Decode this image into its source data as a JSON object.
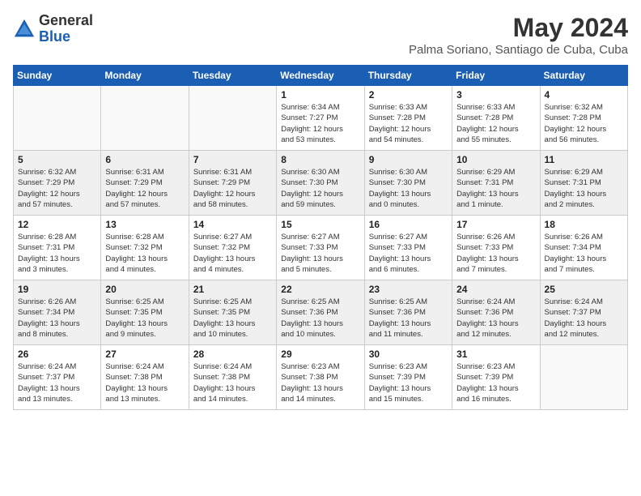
{
  "logo": {
    "general": "General",
    "blue": "Blue"
  },
  "title": "May 2024",
  "subtitle": "Palma Soriano, Santiago de Cuba, Cuba",
  "days_of_week": [
    "Sunday",
    "Monday",
    "Tuesday",
    "Wednesday",
    "Thursday",
    "Friday",
    "Saturday"
  ],
  "weeks": [
    [
      {
        "day": "",
        "info": ""
      },
      {
        "day": "",
        "info": ""
      },
      {
        "day": "",
        "info": ""
      },
      {
        "day": "1",
        "info": "Sunrise: 6:34 AM\nSunset: 7:27 PM\nDaylight: 12 hours\nand 53 minutes."
      },
      {
        "day": "2",
        "info": "Sunrise: 6:33 AM\nSunset: 7:28 PM\nDaylight: 12 hours\nand 54 minutes."
      },
      {
        "day": "3",
        "info": "Sunrise: 6:33 AM\nSunset: 7:28 PM\nDaylight: 12 hours\nand 55 minutes."
      },
      {
        "day": "4",
        "info": "Sunrise: 6:32 AM\nSunset: 7:28 PM\nDaylight: 12 hours\nand 56 minutes."
      }
    ],
    [
      {
        "day": "5",
        "info": "Sunrise: 6:32 AM\nSunset: 7:29 PM\nDaylight: 12 hours\nand 57 minutes."
      },
      {
        "day": "6",
        "info": "Sunrise: 6:31 AM\nSunset: 7:29 PM\nDaylight: 12 hours\nand 57 minutes."
      },
      {
        "day": "7",
        "info": "Sunrise: 6:31 AM\nSunset: 7:29 PM\nDaylight: 12 hours\nand 58 minutes."
      },
      {
        "day": "8",
        "info": "Sunrise: 6:30 AM\nSunset: 7:30 PM\nDaylight: 12 hours\nand 59 minutes."
      },
      {
        "day": "9",
        "info": "Sunrise: 6:30 AM\nSunset: 7:30 PM\nDaylight: 13 hours\nand 0 minutes."
      },
      {
        "day": "10",
        "info": "Sunrise: 6:29 AM\nSunset: 7:31 PM\nDaylight: 13 hours\nand 1 minute."
      },
      {
        "day": "11",
        "info": "Sunrise: 6:29 AM\nSunset: 7:31 PM\nDaylight: 13 hours\nand 2 minutes."
      }
    ],
    [
      {
        "day": "12",
        "info": "Sunrise: 6:28 AM\nSunset: 7:31 PM\nDaylight: 13 hours\nand 3 minutes."
      },
      {
        "day": "13",
        "info": "Sunrise: 6:28 AM\nSunset: 7:32 PM\nDaylight: 13 hours\nand 4 minutes."
      },
      {
        "day": "14",
        "info": "Sunrise: 6:27 AM\nSunset: 7:32 PM\nDaylight: 13 hours\nand 4 minutes."
      },
      {
        "day": "15",
        "info": "Sunrise: 6:27 AM\nSunset: 7:33 PM\nDaylight: 13 hours\nand 5 minutes."
      },
      {
        "day": "16",
        "info": "Sunrise: 6:27 AM\nSunset: 7:33 PM\nDaylight: 13 hours\nand 6 minutes."
      },
      {
        "day": "17",
        "info": "Sunrise: 6:26 AM\nSunset: 7:33 PM\nDaylight: 13 hours\nand 7 minutes."
      },
      {
        "day": "18",
        "info": "Sunrise: 6:26 AM\nSunset: 7:34 PM\nDaylight: 13 hours\nand 7 minutes."
      }
    ],
    [
      {
        "day": "19",
        "info": "Sunrise: 6:26 AM\nSunset: 7:34 PM\nDaylight: 13 hours\nand 8 minutes."
      },
      {
        "day": "20",
        "info": "Sunrise: 6:25 AM\nSunset: 7:35 PM\nDaylight: 13 hours\nand 9 minutes."
      },
      {
        "day": "21",
        "info": "Sunrise: 6:25 AM\nSunset: 7:35 PM\nDaylight: 13 hours\nand 10 minutes."
      },
      {
        "day": "22",
        "info": "Sunrise: 6:25 AM\nSunset: 7:36 PM\nDaylight: 13 hours\nand 10 minutes."
      },
      {
        "day": "23",
        "info": "Sunrise: 6:25 AM\nSunset: 7:36 PM\nDaylight: 13 hours\nand 11 minutes."
      },
      {
        "day": "24",
        "info": "Sunrise: 6:24 AM\nSunset: 7:36 PM\nDaylight: 13 hours\nand 12 minutes."
      },
      {
        "day": "25",
        "info": "Sunrise: 6:24 AM\nSunset: 7:37 PM\nDaylight: 13 hours\nand 12 minutes."
      }
    ],
    [
      {
        "day": "26",
        "info": "Sunrise: 6:24 AM\nSunset: 7:37 PM\nDaylight: 13 hours\nand 13 minutes."
      },
      {
        "day": "27",
        "info": "Sunrise: 6:24 AM\nSunset: 7:38 PM\nDaylight: 13 hours\nand 13 minutes."
      },
      {
        "day": "28",
        "info": "Sunrise: 6:24 AM\nSunset: 7:38 PM\nDaylight: 13 hours\nand 14 minutes."
      },
      {
        "day": "29",
        "info": "Sunrise: 6:23 AM\nSunset: 7:38 PM\nDaylight: 13 hours\nand 14 minutes."
      },
      {
        "day": "30",
        "info": "Sunrise: 6:23 AM\nSunset: 7:39 PM\nDaylight: 13 hours\nand 15 minutes."
      },
      {
        "day": "31",
        "info": "Sunrise: 6:23 AM\nSunset: 7:39 PM\nDaylight: 13 hours\nand 16 minutes."
      },
      {
        "day": "",
        "info": ""
      }
    ]
  ]
}
